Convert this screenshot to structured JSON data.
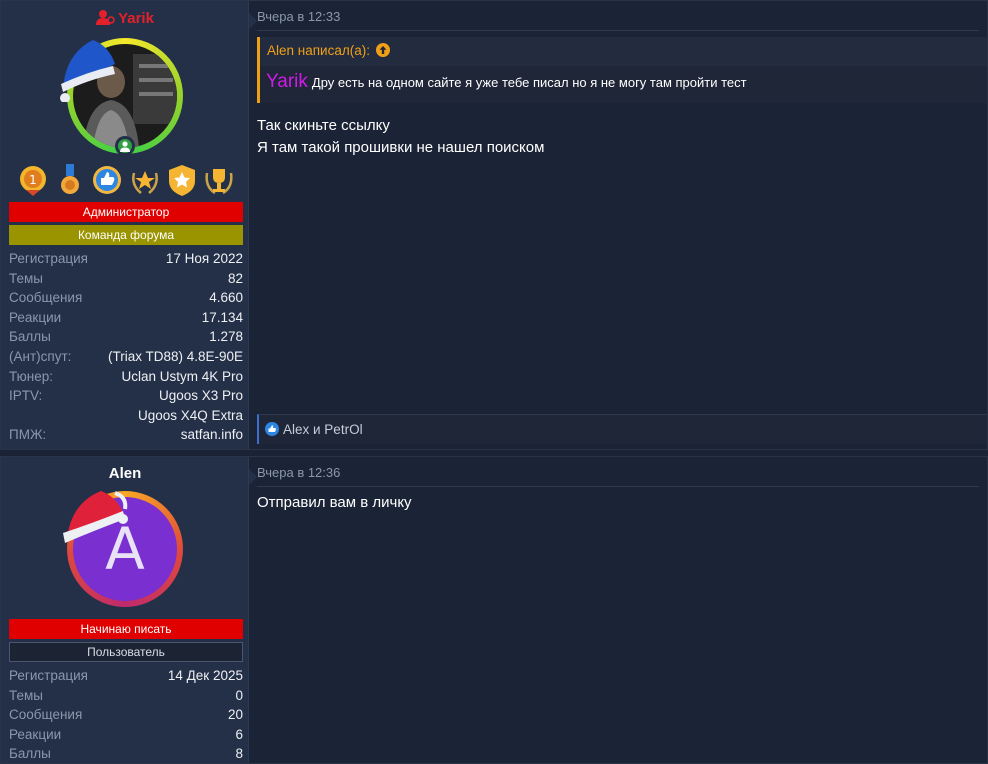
{
  "posts": [
    {
      "author": "Yarik",
      "roles": [
        "Администратор",
        "Команда форума"
      ],
      "stats": [
        {
          "k": "Регистрация",
          "v": "17 Ноя 2022"
        },
        {
          "k": "Темы",
          "v": "82"
        },
        {
          "k": "Сообщения",
          "v": "4.660"
        },
        {
          "k": "Реакции",
          "v": "17.134"
        },
        {
          "k": "Баллы",
          "v": "1.278"
        },
        {
          "k": "(Ант)спут:",
          "v": "(Triax TD88) 4.8E-90E"
        },
        {
          "k": "Тюнер:",
          "v": "Uclan Ustym 4K Pro"
        },
        {
          "k": "IPTV:",
          "v": "Ugoos X3 Pro"
        },
        {
          "k": "",
          "v": "Ugoos X4Q Extra"
        },
        {
          "k": "ПМЖ:",
          "v": "satfan.info"
        }
      ],
      "time": "Вчера в 12:33",
      "quote_header": "Alen написал(а):",
      "quote_name": "Yarik",
      "quote_text": "Дру есть на одном сайте я уже тебе писал но я не могу там пройти тест",
      "lines": [
        "Так скиньте ссылку",
        "Я там такой прошивки не нашел поиском"
      ],
      "reactions": "Alex и PetrOl"
    },
    {
      "author": "Alen",
      "avatar_letter": "A",
      "roles": [
        "Начинаю писать",
        "Пользователь"
      ],
      "stats": [
        {
          "k": "Регистрация",
          "v": "14 Дек 2025"
        },
        {
          "k": "Темы",
          "v": "0"
        },
        {
          "k": "Сообщения",
          "v": "20"
        },
        {
          "k": "Реакции",
          "v": "6"
        },
        {
          "k": "Баллы",
          "v": "8"
        }
      ],
      "time": "Вчера в 12:36",
      "lines": [
        "Отправил вам в личку"
      ]
    }
  ],
  "colors": {
    "admin": "#e00000",
    "team": "#9a9400",
    "quote_accent": "#f0a016",
    "quote_name": "#d01be6"
  }
}
